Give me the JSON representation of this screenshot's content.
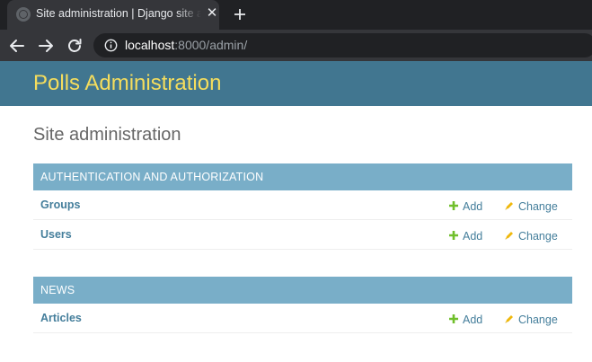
{
  "browser": {
    "tab_title": "Site administration | Django site admin",
    "url_host": "localhost",
    "url_rest": ":8000/admin/"
  },
  "icons": {
    "tab_favicon": "globe-icon",
    "tab_close": "close-icon",
    "new_tab": "plus-icon",
    "back": "arrow-left-icon",
    "forward": "arrow-right-icon",
    "reload": "reload-icon",
    "site_info": "info-icon",
    "add": "plus-icon",
    "change": "pencil-icon"
  },
  "colors": {
    "header_bg": "#417690",
    "site_name": "#f5dd5d",
    "caption_bg": "#79aec8",
    "link": "#447e9b",
    "add_icon": "#70bf2b",
    "change_icon": "#efb80b"
  },
  "header": {
    "site_name": "Polls Administration"
  },
  "content": {
    "title": "Site administration",
    "modules": [
      {
        "caption": "AUTHENTICATION AND AUTHORIZATION",
        "rows": [
          {
            "name": "Groups",
            "add_label": "Add",
            "change_label": "Change"
          },
          {
            "name": "Users",
            "add_label": "Add",
            "change_label": "Change"
          }
        ]
      },
      {
        "caption": "NEWS",
        "rows": [
          {
            "name": "Articles",
            "add_label": "Add",
            "change_label": "Change"
          }
        ]
      }
    ]
  }
}
